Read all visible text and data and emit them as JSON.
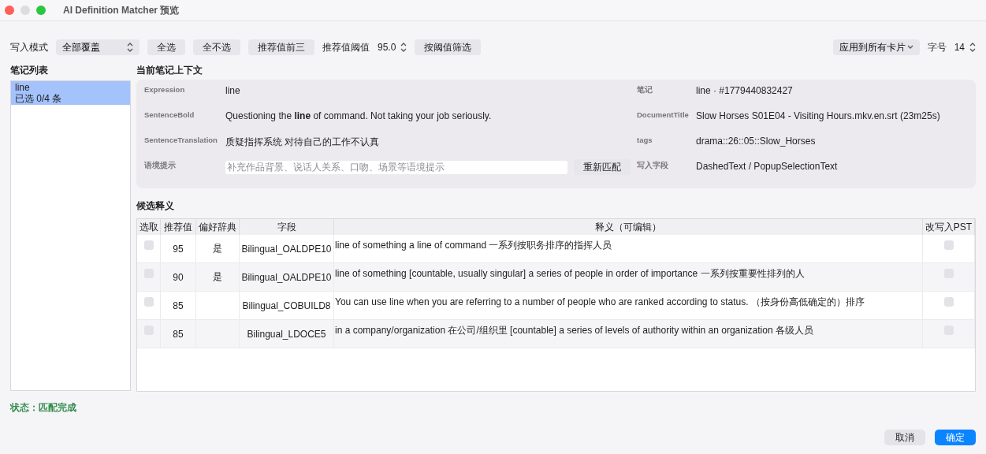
{
  "window": {
    "title": "AI Definition Matcher 预览"
  },
  "toolbar": {
    "write_mode_label": "写入模式",
    "write_mode_value": "全部覆盖",
    "buttons": [
      "全选",
      "全不选",
      "推荐值前三"
    ],
    "threshold_label": "推荐值阈值",
    "threshold_value": "95.0",
    "filter_button": "按阈值筛选",
    "apply_value": "应用到所有卡片",
    "font_size_label": "字号",
    "font_size_value": "14"
  },
  "notes": {
    "title": "笔记列表",
    "items": [
      {
        "word": "line",
        "status": "已选 0/4 条",
        "selected": true
      }
    ]
  },
  "context": {
    "title": "当前笔记上下文",
    "left": [
      {
        "label": "Expression",
        "value": "line"
      },
      {
        "label": "SentenceBold",
        "value": "Questioning the **line** of command. Not taking your job seriously."
      },
      {
        "label": "SentenceTranslation",
        "value": "质疑指挥系统 对待自己的工作不认真"
      }
    ],
    "hint": {
      "label": "语境提示",
      "placeholder": "补充作品背景、说话人关系、口吻、场景等语境提示",
      "button": "重新匹配"
    },
    "right": [
      {
        "label": "笔记",
        "value": "line · #1779440832427"
      },
      {
        "label": "DocumentTitle",
        "value": "Slow Horses S01E04 - Visiting Hours.mkv.en.srt (23m25s)"
      },
      {
        "label": "tags",
        "value": "drama::26::05::Slow_Horses"
      },
      {
        "label": "写入字段",
        "value": "DashedText / PopupSelectionText"
      }
    ]
  },
  "candidates": {
    "title": "候选释义",
    "columns": [
      "选取",
      "推荐值",
      "偏好辞典",
      "字段",
      "释义（可编辑）",
      "改写入PST"
    ],
    "rows": [
      {
        "checked": false,
        "score": "95",
        "preferred": "是",
        "field": "Bilingual_OALDPE10",
        "definition": "line of something a line of command 一系列按职务排序的指挥人员",
        "rewrite": false
      },
      {
        "checked": false,
        "score": "90",
        "preferred": "是",
        "field": "Bilingual_OALDPE10",
        "definition": "line of something [countable, usually singular] a series of people in order of importance 一系列按重要性排列的人",
        "rewrite": false
      },
      {
        "checked": false,
        "score": "85",
        "field": "Bilingual_COBUILD8",
        "definition": "You can use line when you are referring to a number of people who are ranked according to status. （按身份高低确定的）排序",
        "rewrite": false
      },
      {
        "checked": false,
        "score": "85",
        "field": "Bilingual_LDOCE5",
        "definition": "in a company/organization 在公司/组织里 [countable] a series of levels of authority within an organization 各级人员",
        "rewrite": false
      }
    ]
  },
  "status": "状态：匹配完成",
  "footer": [
    {
      "label": "取消",
      "kind": "secondary"
    },
    {
      "label": "确定",
      "kind": "primary"
    }
  ]
}
